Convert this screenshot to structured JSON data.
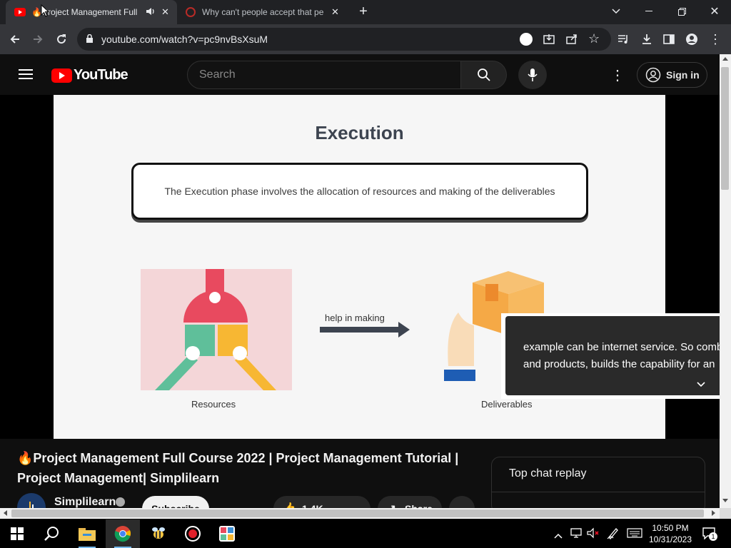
{
  "browser": {
    "tabs": [
      {
        "title": "🔥Project Management Full",
        "active": true
      },
      {
        "title": "Why can't people accept that pe",
        "active": false
      }
    ],
    "url": "youtube.com/watch?v=pc9nvBsXsuM"
  },
  "youtube": {
    "logo_text": "YouTube",
    "search_placeholder": "Search",
    "signin_label": "Sign in"
  },
  "slide": {
    "title": "Execution",
    "box_text": "The Execution phase involves the allocation of resources and making of the deliverables",
    "arrow_label": "help in making",
    "left_label": "Resources",
    "right_label": "Deliverables"
  },
  "captions": {
    "line1": "example can be internet service. So comb",
    "line2": "and products, builds the capability for an"
  },
  "video": {
    "title": "🔥Project Management Full Course 2022 | Project Management Tutorial | Project Management| Simplilearn",
    "channel": "Simplilearn",
    "subscribe_label": "Subscribe",
    "likes": "1.4K",
    "share_label": "Share"
  },
  "chat": {
    "title": "Top chat replay"
  },
  "taskbar": {
    "time": "10:50 PM",
    "date": "10/31/2023",
    "notification_count": "1"
  },
  "colors": {
    "youtube_red": "#ff0000",
    "slide_bg": "#f6f6f6",
    "caption_bg": "#2a2a2a"
  }
}
